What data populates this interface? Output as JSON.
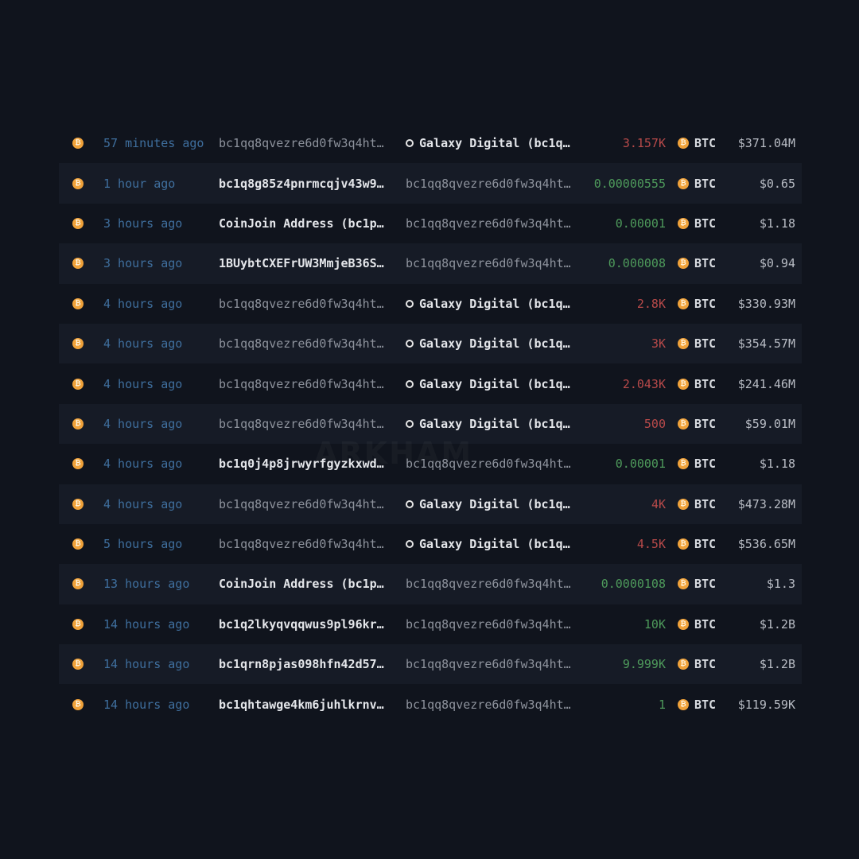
{
  "watermark": "ARKHAM",
  "chain_icon_glyph": "₿",
  "token_icon_glyph": "₿",
  "colors": {
    "background": "#10141d",
    "row_alt": "#161b26",
    "time": "#3f6f9e",
    "outflow": "#b84a4a",
    "inflow": "#4e9a5b",
    "btc_orange": "#f0a23a"
  },
  "rows": [
    {
      "time": "57 minutes ago",
      "from": "bc1qq8qvezre6d0fw3q4ht…",
      "to": "Galaxy Digital (bc1q…",
      "amount": "3.157K",
      "token": "BTC",
      "usd": "$371.04M"
    },
    {
      "time": "1 hour ago",
      "from": "bc1q8g85z4pnrmcqjv43w9…",
      "to": "bc1qq8qvezre6d0fw3q4ht…",
      "amount": "0.00000555",
      "token": "BTC",
      "usd": "$0.65"
    },
    {
      "time": "3 hours ago",
      "from": "CoinJoin Address (bc1p…",
      "to": "bc1qq8qvezre6d0fw3q4ht…",
      "amount": "0.00001",
      "token": "BTC",
      "usd": "$1.18"
    },
    {
      "time": "3 hours ago",
      "from": "1BUybtCXEFrUW3MmjeB36S…",
      "to": "bc1qq8qvezre6d0fw3q4ht…",
      "amount": "0.000008",
      "token": "BTC",
      "usd": "$0.94"
    },
    {
      "time": "4 hours ago",
      "from": "bc1qq8qvezre6d0fw3q4ht…",
      "to": "Galaxy Digital (bc1q…",
      "amount": "2.8K",
      "token": "BTC",
      "usd": "$330.93M"
    },
    {
      "time": "4 hours ago",
      "from": "bc1qq8qvezre6d0fw3q4ht…",
      "to": "Galaxy Digital (bc1q…",
      "amount": "3K",
      "token": "BTC",
      "usd": "$354.57M"
    },
    {
      "time": "4 hours ago",
      "from": "bc1qq8qvezre6d0fw3q4ht…",
      "to": "Galaxy Digital (bc1q…",
      "amount": "2.043K",
      "token": "BTC",
      "usd": "$241.46M"
    },
    {
      "time": "4 hours ago",
      "from": "bc1qq8qvezre6d0fw3q4ht…",
      "to": "Galaxy Digital (bc1q…",
      "amount": "500",
      "token": "BTC",
      "usd": "$59.01M"
    },
    {
      "time": "4 hours ago",
      "from": "bc1q0j4p8jrwyrfgyzkxwd…",
      "to": "bc1qq8qvezre6d0fw3q4ht…",
      "amount": "0.00001",
      "token": "BTC",
      "usd": "$1.18"
    },
    {
      "time": "4 hours ago",
      "from": "bc1qq8qvezre6d0fw3q4ht…",
      "to": "Galaxy Digital (bc1q…",
      "amount": "4K",
      "token": "BTC",
      "usd": "$473.28M"
    },
    {
      "time": "5 hours ago",
      "from": "bc1qq8qvezre6d0fw3q4ht…",
      "to": "Galaxy Digital (bc1q…",
      "amount": "4.5K",
      "token": "BTC",
      "usd": "$536.65M"
    },
    {
      "time": "13 hours ago",
      "from": "CoinJoin Address (bc1p…",
      "to": "bc1qq8qvezre6d0fw3q4ht…",
      "amount": "0.0000108",
      "token": "BTC",
      "usd": "$1.3"
    },
    {
      "time": "14 hours ago",
      "from": "bc1q2lkyqvqqwus9pl96kr…",
      "to": "bc1qq8qvezre6d0fw3q4ht…",
      "amount": "10K",
      "token": "BTC",
      "usd": "$1.2B"
    },
    {
      "time": "14 hours ago",
      "from": "bc1qrn8pjas098hfn42d57…",
      "to": "bc1qq8qvezre6d0fw3q4ht…",
      "amount": "9.999K",
      "token": "BTC",
      "usd": "$1.2B"
    },
    {
      "time": "14 hours ago",
      "from": "bc1qhtawge4km6juhlkrnv…",
      "to": "bc1qq8qvezre6d0fw3q4ht…",
      "amount": "1",
      "token": "BTC",
      "usd": "$119.59K"
    }
  ]
}
